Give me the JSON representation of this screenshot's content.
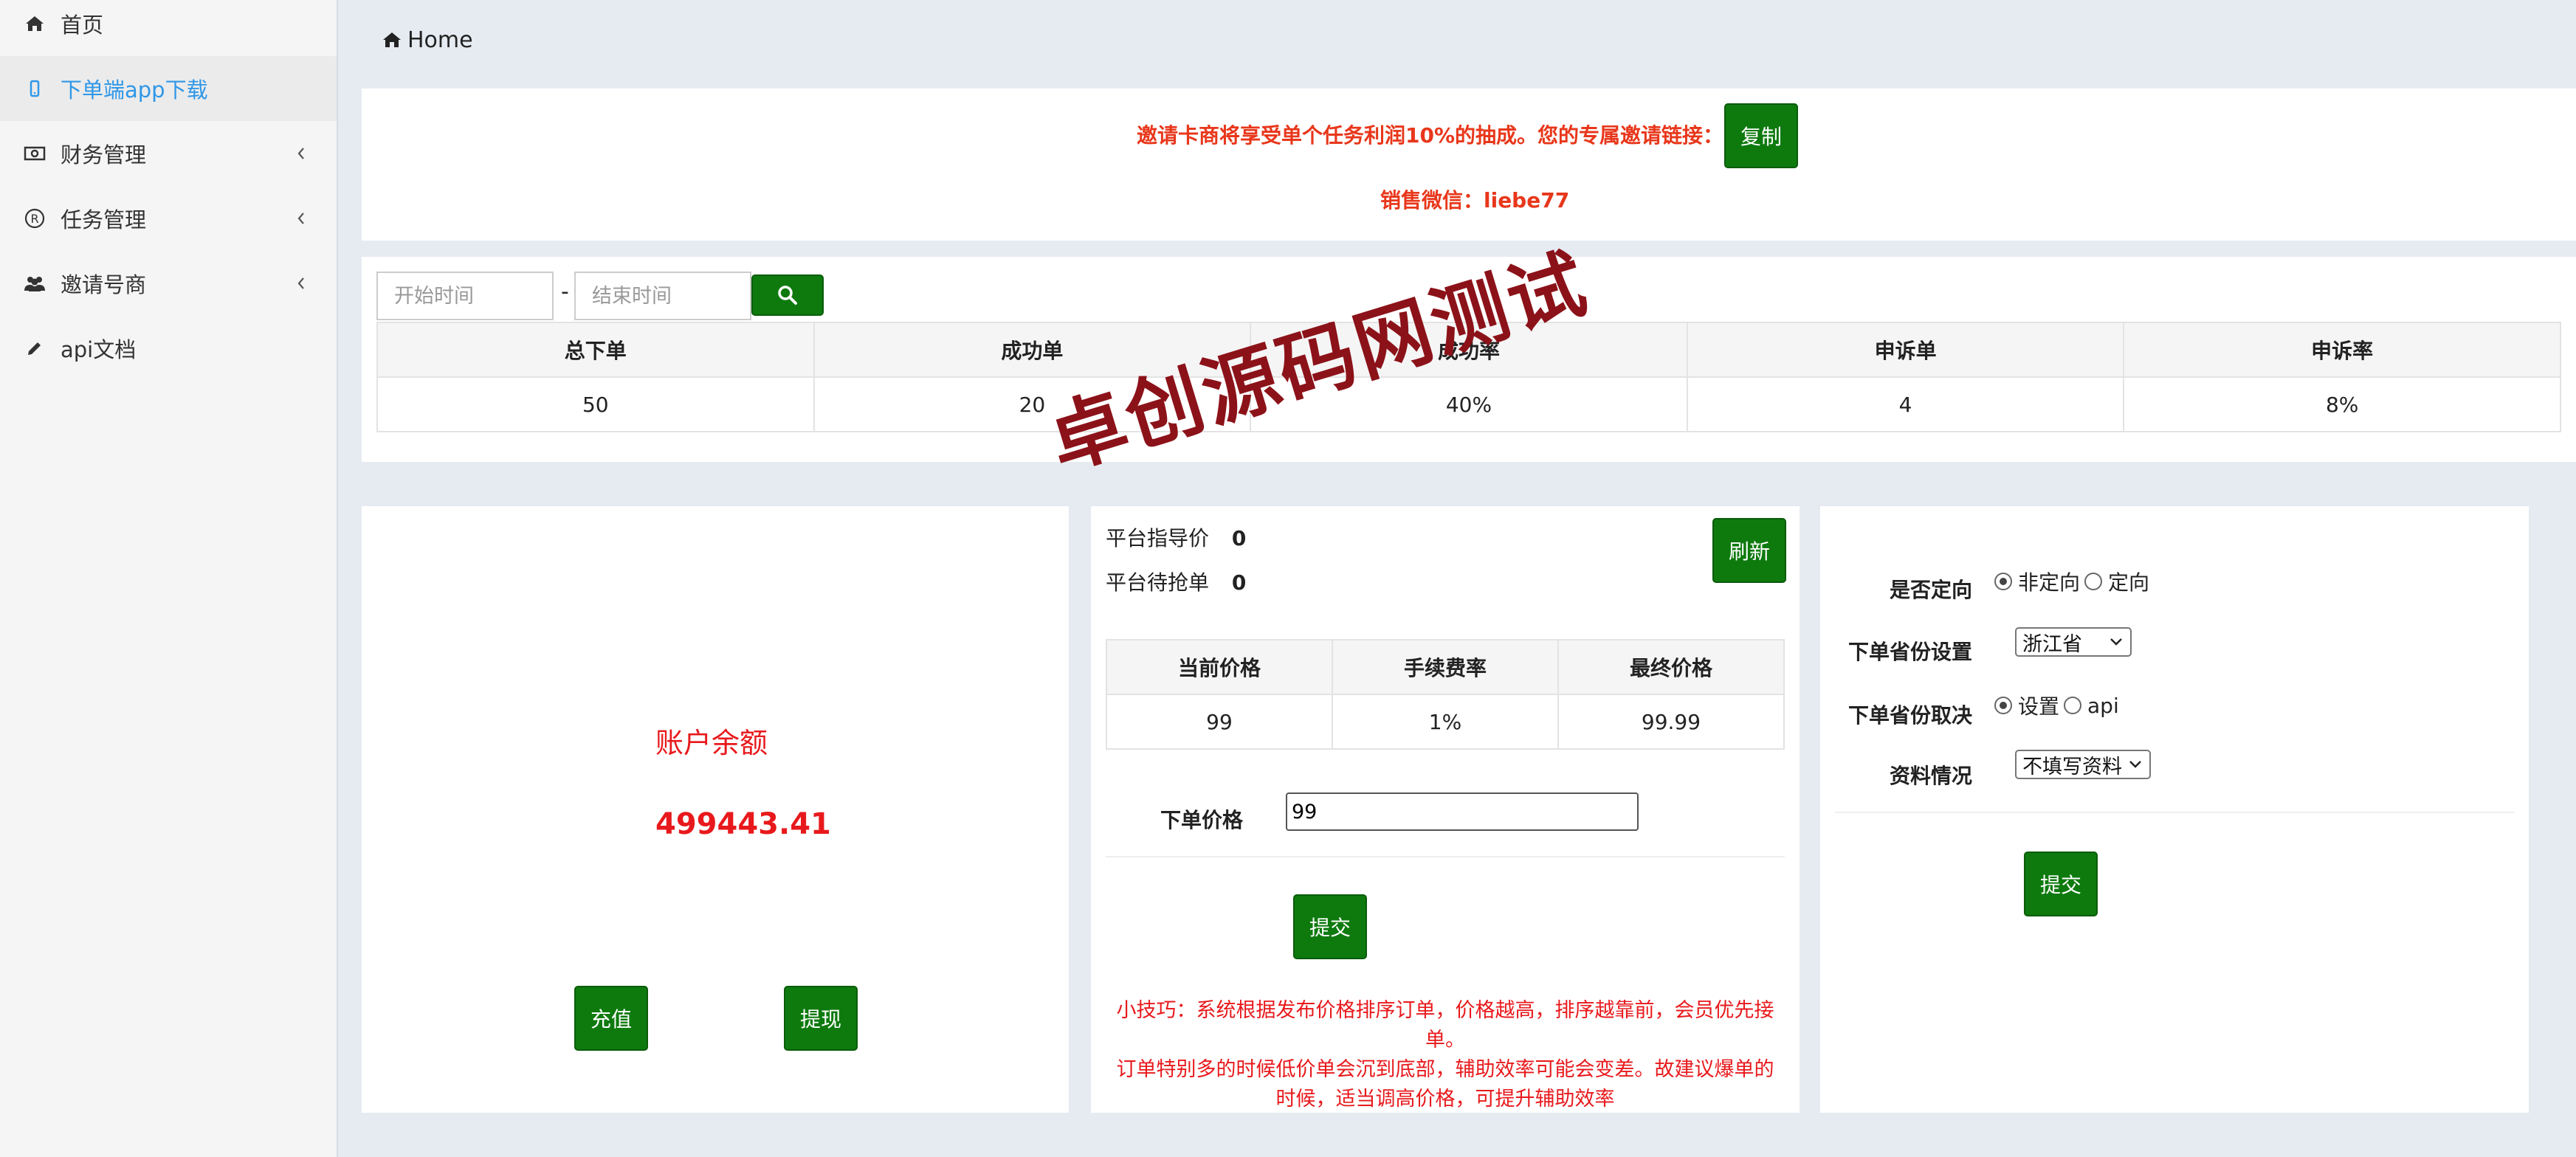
{
  "sidebar": {
    "items": [
      {
        "label": "首页",
        "icon": "home-icon"
      },
      {
        "label": "下单端app下载",
        "icon": "mobile-icon",
        "active": true
      },
      {
        "label": "财务管理",
        "icon": "money-icon",
        "expandable": true
      },
      {
        "label": "任务管理",
        "icon": "registered-icon",
        "expandable": true
      },
      {
        "label": "邀请号商",
        "icon": "users-icon",
        "expandable": true
      },
      {
        "label": "api文档",
        "icon": "pencil-icon"
      }
    ]
  },
  "breadcrumb": {
    "label": "Home"
  },
  "invite": {
    "text": "邀请卡商将享受单个任务利润10%的抽成。您的专属邀请链接：",
    "copy_label": "复制",
    "wechat": "销售微信：liebe77"
  },
  "filter": {
    "start_placeholder": "开始时间",
    "end_placeholder": "结束时间",
    "separator": "-"
  },
  "stats": {
    "headers": [
      "总下单",
      "成功单",
      "成功率",
      "申诉单",
      "申诉率"
    ],
    "values": [
      "50",
      "20",
      "40%",
      "4",
      "8%"
    ]
  },
  "watermark": "卓创源码网测试",
  "account": {
    "balance_label": "账户余额",
    "balance": "499443.41",
    "recharge_label": "充值",
    "withdraw_label": "提现"
  },
  "pricing": {
    "guide_label": "平台指导价",
    "guide_value": "0",
    "pending_label": "平台待抢单",
    "pending_value": "0",
    "refresh_label": "刷新",
    "headers": [
      "当前价格",
      "手续费率",
      "最终价格"
    ],
    "values": [
      "99",
      "1%",
      "99.99"
    ],
    "order_price_label": "下单价格",
    "order_price_value": "99",
    "submit_label": "提交",
    "tip_1": "小技巧：系统根据发布价格排序订单，价格越高，排序越靠前，会员优先接单。",
    "tip_2": "订单特别多的时候低价单会沉到底部，辅助效率可能会变差。故建议爆单的时候，适当调高价格，可提升辅助效率"
  },
  "settings": {
    "directed_label": "是否定向",
    "directed_options": [
      "非定向",
      "定向"
    ],
    "province_label": "下单省份设置",
    "province_value": "浙江省",
    "province_source_label": "下单省份取决",
    "province_source_options": [
      "设置",
      "api"
    ],
    "info_label": "资料情况",
    "info_value": "不填写资料",
    "submit_label": "提交"
  },
  "colors": {
    "accent_green": "#0e7a0e",
    "alert_red": "#e8371b",
    "balance_red": "#e8191c",
    "active_blue": "#2e97e8",
    "watermark": "#8c1219"
  }
}
